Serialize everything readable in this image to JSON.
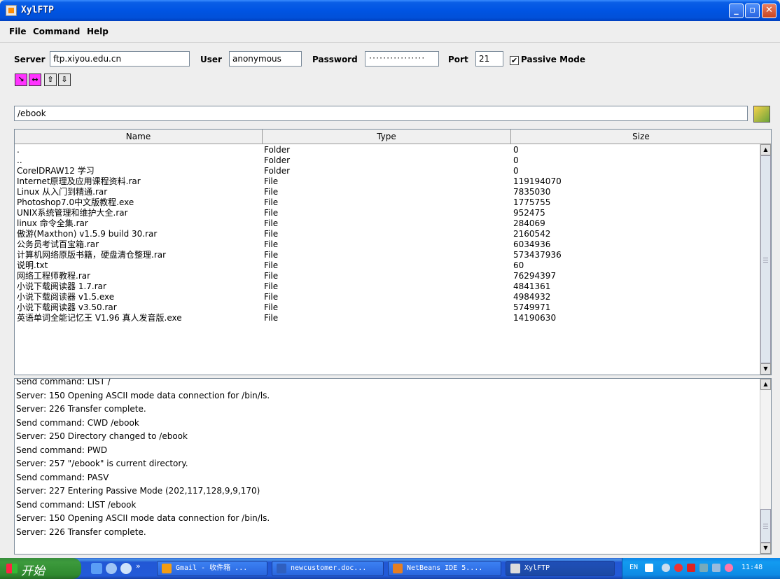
{
  "window": {
    "title": "XylFTP"
  },
  "menu": [
    "File",
    "Command",
    "Help"
  ],
  "connection": {
    "server_label": "Server",
    "server_value": "ftp.xiyou.edu.cn",
    "user_label": "User",
    "user_value": "anonymous",
    "password_label": "Password",
    "password_value": "················",
    "port_label": "Port",
    "port_value": "21",
    "passive_label": "Passive Mode",
    "passive_checked": true
  },
  "toolbar": {
    "icons": [
      "connect-icon",
      "disconnect-icon",
      "upload-icon",
      "download-icon"
    ],
    "glyphs": [
      "↘",
      "↔",
      "⇧",
      "⇩"
    ]
  },
  "path": {
    "value": "/ebook"
  },
  "table": {
    "columns": [
      "Name",
      "Type",
      "Size"
    ],
    "rows": [
      [
        ".",
        "Folder",
        "0"
      ],
      [
        "..",
        "Folder",
        "0"
      ],
      [
        "CorelDRAW12 学习",
        "Folder",
        "0"
      ],
      [
        "Internet原理及应用课程资料.rar",
        "File",
        "119194070"
      ],
      [
        "Linux 从入门到精通.rar",
        "File",
        "7835030"
      ],
      [
        "Photoshop7.0中文版教程.exe",
        "File",
        "1775755"
      ],
      [
        "UNIX系统管理和维护大全.rar",
        "File",
        "952475"
      ],
      [
        "linux 命令全集.rar",
        "File",
        "284069"
      ],
      [
        "傲游(Maxthon) v1.5.9 build 30.rar",
        "File",
        "2160542"
      ],
      [
        "公务员考试百宝箱.rar",
        "File",
        "6034936"
      ],
      [
        "计算机网络原版书籍，硬盘清仓整理.rar",
        "File",
        "573437936"
      ],
      [
        "说明.txt",
        "File",
        "60"
      ],
      [
        "网络工程师教程.rar",
        "File",
        "76294397"
      ],
      [
        "小说下载阅读器 1.7.rar",
        "File",
        "4841361"
      ],
      [
        "小说下载阅读器 v1.5.exe",
        "File",
        "4984932"
      ],
      [
        "小说下载阅读器 v3.50.rar",
        "File",
        "5749971"
      ],
      [
        "英语单词全能记忆王 V1.96 真人发音版.exe",
        "File",
        "14190630"
      ]
    ]
  },
  "log": [
    "Send command: LIST /",
    "Server: 150 Opening ASCII mode data connection for /bin/ls.",
    "Server: 226 Transfer complete.",
    "Send command: CWD /ebook",
    "Server: 250 Directory changed to /ebook",
    "Send command: PWD",
    "Server: 257 \"/ebook\" is current directory.",
    "Send command: PASV",
    "Server: 227 Entering Passive Mode (202,117,128,9,9,170)",
    "Send command: LIST /ebook",
    "Server: 150 Opening ASCII mode data connection for /bin/ls.",
    "Server: 226 Transfer complete."
  ],
  "taskbar": {
    "start_label": "开始",
    "overflow": "»",
    "tasks": [
      {
        "label": "Gmail - 收件箱 ...",
        "icon": "firefox-icon",
        "color": "#f39c12"
      },
      {
        "label": "newcustomer.doc...",
        "icon": "word-icon",
        "color": "#2f5fbf"
      },
      {
        "label": "NetBeans IDE 5....",
        "icon": "netbeans-icon",
        "color": "#e67e22"
      },
      {
        "label": "XylFTP",
        "icon": "java-icon",
        "color": "#dcdcdc",
        "active": true
      }
    ],
    "tray_lang": "EN",
    "clock": "11:48"
  }
}
